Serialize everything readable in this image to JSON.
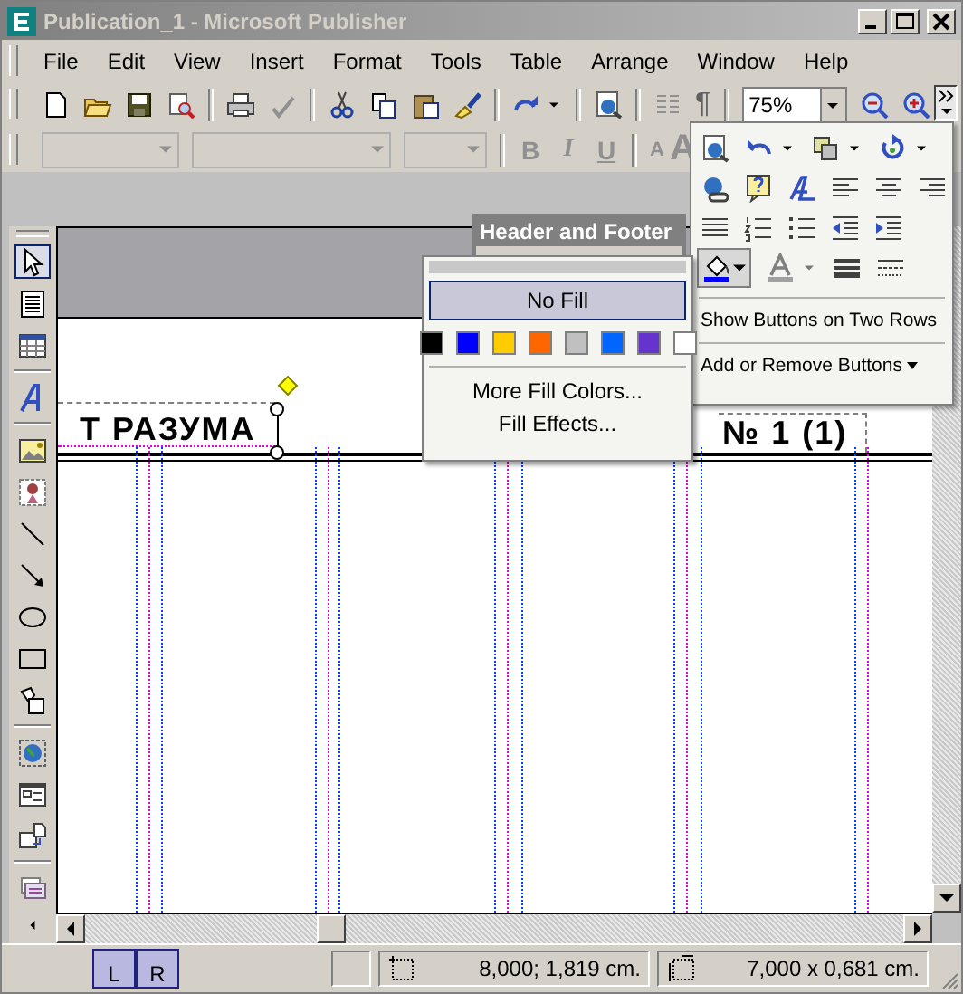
{
  "window": {
    "title": "Publication_1 - Microsoft Publisher"
  },
  "menu": [
    {
      "label": "File"
    },
    {
      "label": "Edit"
    },
    {
      "label": "View"
    },
    {
      "label": "Insert"
    },
    {
      "label": "Format"
    },
    {
      "label": "Tools"
    },
    {
      "label": "Table"
    },
    {
      "label": "Arrange"
    },
    {
      "label": "Window"
    },
    {
      "label": "Help"
    }
  ],
  "standard_toolbar": {
    "pilcrow": "¶",
    "zoom": "75%",
    "chevron_pressed": true
  },
  "formatting_toolbar": {
    "buttons": [
      {
        "label": "B",
        "disabled": true
      },
      {
        "label": "I",
        "disabled": true
      },
      {
        "label": "U",
        "disabled": true
      }
    ],
    "size_buttons": [
      {
        "label": "A",
        "disabled": true
      },
      {
        "label": "A",
        "disabled": true
      }
    ]
  },
  "objects_toolbar": {
    "tools": [
      {
        "selected": true
      },
      {
        "selected": false
      },
      {
        "selected": false
      },
      {
        "selected": false
      },
      {
        "selected": false
      },
      {
        "selected": false
      },
      {
        "selected": false
      },
      {
        "selected": false
      },
      {
        "selected": false
      },
      {
        "selected": false
      },
      {
        "selected": false
      },
      {
        "selected": false
      },
      {
        "selected": false
      },
      {
        "selected": false
      },
      {
        "selected": false
      }
    ]
  },
  "page": {
    "header_left": "Т РАЗУМА",
    "header_right": "№ 1 (1)"
  },
  "header_footer_toolbar": {
    "title": "Header and Footer"
  },
  "fill_popup": {
    "no_fill": {
      "label": "No Fill",
      "selected": true
    },
    "swatches": [
      {
        "color": "#000000"
      },
      {
        "color": "#0000ff"
      },
      {
        "color": "#ffcc00"
      },
      {
        "color": "#ff6600"
      },
      {
        "color": "#c0c0c0"
      },
      {
        "color": "#0066ff"
      },
      {
        "color": "#6633cc"
      },
      {
        "color": "#ffffff"
      }
    ],
    "items": [
      {
        "label": "More Fill Colors..."
      },
      {
        "label": "Fill Effects..."
      }
    ]
  },
  "overflow_panel": {
    "fill_pressed": true,
    "items": [
      {
        "label": "Show Buttons on Two Rows"
      },
      {
        "label": "Add or Remove Buttons"
      }
    ]
  },
  "page_tabs": [
    {
      "label": "L"
    },
    {
      "label": "R"
    }
  ],
  "status_bar": {
    "position": "8,000; 1,819 cm.",
    "size": "7,000 x  0,681 cm."
  }
}
